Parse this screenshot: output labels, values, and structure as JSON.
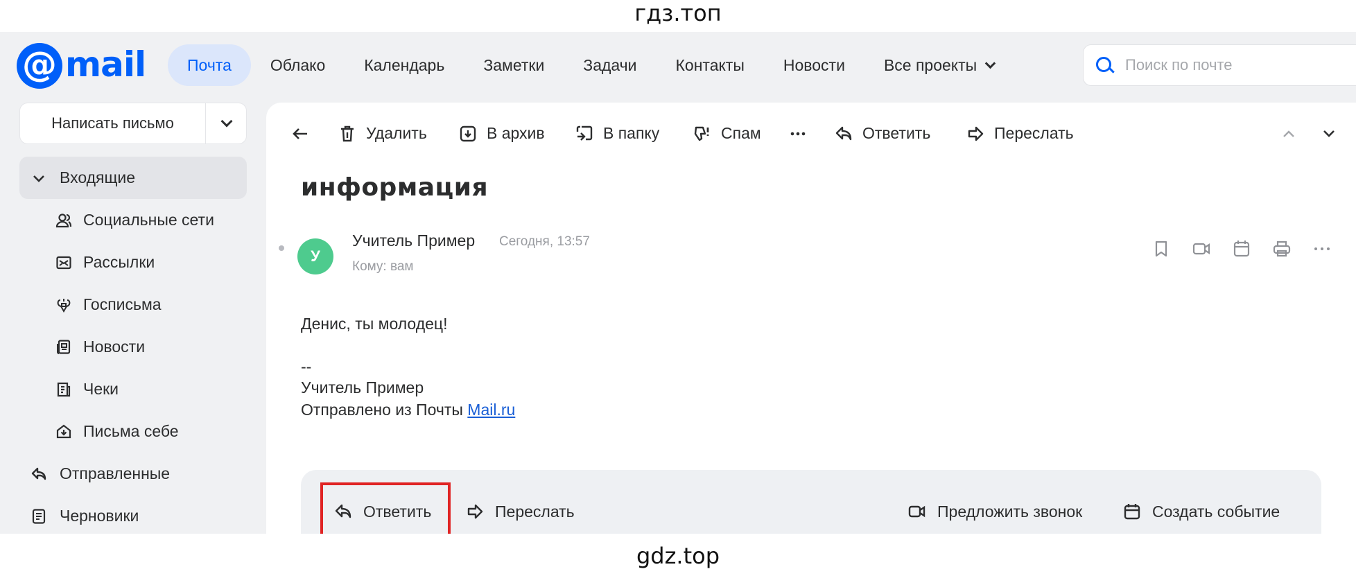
{
  "watermark": {
    "top": "гдз.топ",
    "bottom": "gdz.top"
  },
  "header": {
    "logo_text": "mail",
    "nav": [
      {
        "label": "Почта",
        "active": true
      },
      {
        "label": "Облако"
      },
      {
        "label": "Календарь"
      },
      {
        "label": "Заметки"
      },
      {
        "label": "Задачи"
      },
      {
        "label": "Контакты"
      },
      {
        "label": "Новости"
      },
      {
        "label": "Все проекты"
      }
    ],
    "search_placeholder": "Поиск по почте"
  },
  "compose": {
    "label": "Написать письмо"
  },
  "sidebar": {
    "items": [
      {
        "label": "Входящие",
        "icon": "chevron-down-icon",
        "active": true
      },
      {
        "label": "Социальные сети",
        "icon": "people-icon"
      },
      {
        "label": "Рассылки",
        "icon": "newsletter-icon"
      },
      {
        "label": "Госписьма",
        "icon": "emblem-icon"
      },
      {
        "label": "Новости",
        "icon": "newspaper-icon"
      },
      {
        "label": "Чеки",
        "icon": "receipt-icon"
      },
      {
        "label": "Письма себе",
        "icon": "self-mail-icon"
      },
      {
        "label": "Отправленные",
        "icon": "sent-icon"
      },
      {
        "label": "Черновики",
        "icon": "draft-icon"
      }
    ]
  },
  "toolbar": {
    "delete": "Удалить",
    "archive": "В архив",
    "move": "В папку",
    "spam": "Спам",
    "reply": "Ответить",
    "forward": "Переслать"
  },
  "message": {
    "subject": "информация",
    "avatar_letter": "У",
    "sender": "Учитель Пример",
    "time": "Сегодня, 13:57",
    "to": "Кому: вам",
    "body": "Денис, ты молодец!",
    "sig_sep": "--",
    "sig_name": "Учитель Пример",
    "sig_sent_prefix": "Отправлено из Почты",
    "sig_link": "Mail.ru"
  },
  "replybar": {
    "reply": "Ответить",
    "forward": "Переслать",
    "call": "Предложить звонок",
    "event": "Создать событие"
  },
  "colors": {
    "accent": "#005ff9",
    "avatar": "#4ecb8e",
    "highlight": "#e02424"
  }
}
